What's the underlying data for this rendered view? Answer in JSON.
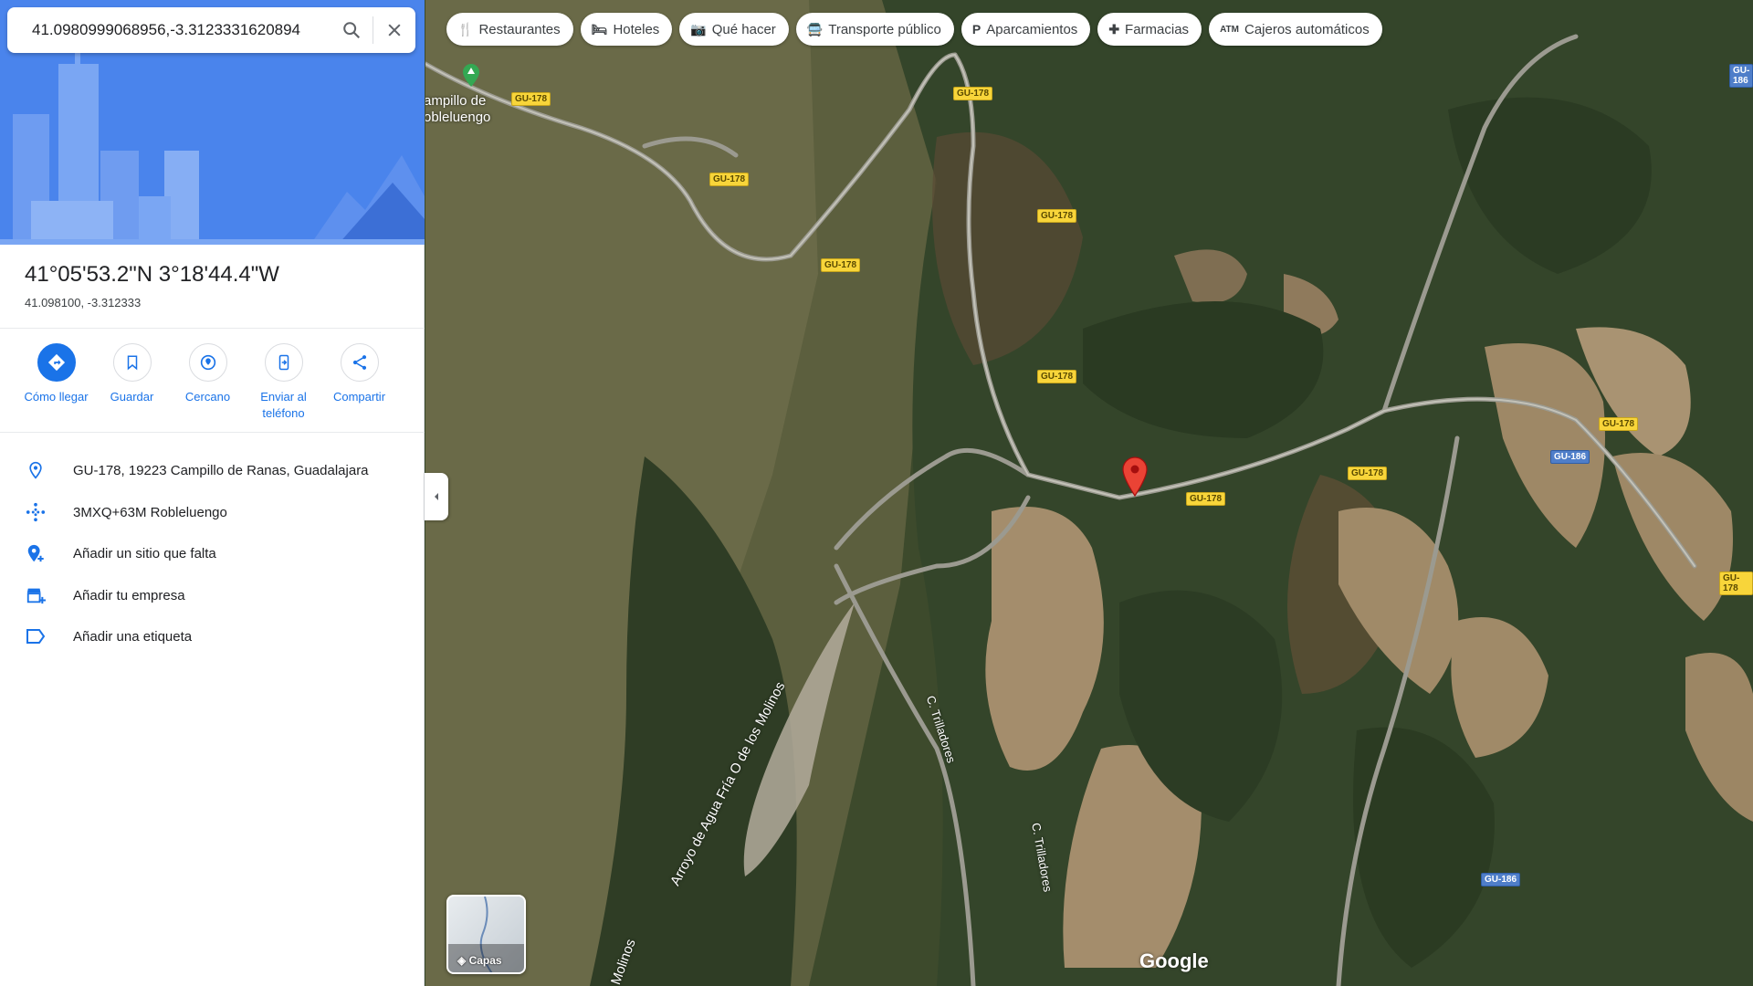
{
  "search": {
    "query": "41.0980999068956,-3.3123331620894"
  },
  "place": {
    "title": "41°05'53.2\"N 3°18'44.4\"W",
    "decimal": "41.098100, -3.312333"
  },
  "actions": [
    {
      "label": "Cómo llegar",
      "icon": "directions-icon"
    },
    {
      "label": "Guardar",
      "icon": "bookmark-icon"
    },
    {
      "label": "Cercano",
      "icon": "nearby-icon"
    },
    {
      "label": "Enviar al teléfono",
      "icon": "send-to-phone-icon"
    },
    {
      "label": "Compartir",
      "icon": "share-icon"
    }
  ],
  "info": [
    {
      "text": "GU-178, 19223 Campillo de Ranas, Guadalajara",
      "icon": "location-pin-icon"
    },
    {
      "text": "3MXQ+63M Robleluengo",
      "icon": "plus-code-icon"
    },
    {
      "text": "Añadir un sitio que falta",
      "icon": "add-place-icon"
    },
    {
      "text": "Añadir tu empresa",
      "icon": "add-business-icon"
    },
    {
      "text": "Añadir una etiqueta",
      "icon": "label-icon"
    }
  ],
  "chips": [
    {
      "label": "Restaurantes",
      "icon": "restaurant-icon"
    },
    {
      "label": "Hoteles",
      "icon": "hotel-icon"
    },
    {
      "label": "Qué hacer",
      "icon": "camera-icon"
    },
    {
      "label": "Transporte público",
      "icon": "transit-icon"
    },
    {
      "label": "Aparcamientos",
      "icon": "parking-icon"
    },
    {
      "label": "Farmacias",
      "icon": "pharmacy-icon"
    },
    {
      "label": "Cajeros automáticos",
      "icon": "atm-icon"
    }
  ],
  "map": {
    "road_labels": [
      "GU-178",
      "GU-186"
    ],
    "place_labels": [
      "ampillo de",
      "obleluengo"
    ],
    "street_labels": [
      "C. Trilladores",
      "Arroyo de Agua Fría O de los Molinos",
      "Molinos"
    ],
    "layers_label": "Capas",
    "attribution": "Google"
  },
  "colors": {
    "accent": "#1a73e8",
    "pin": "#ea4335"
  }
}
